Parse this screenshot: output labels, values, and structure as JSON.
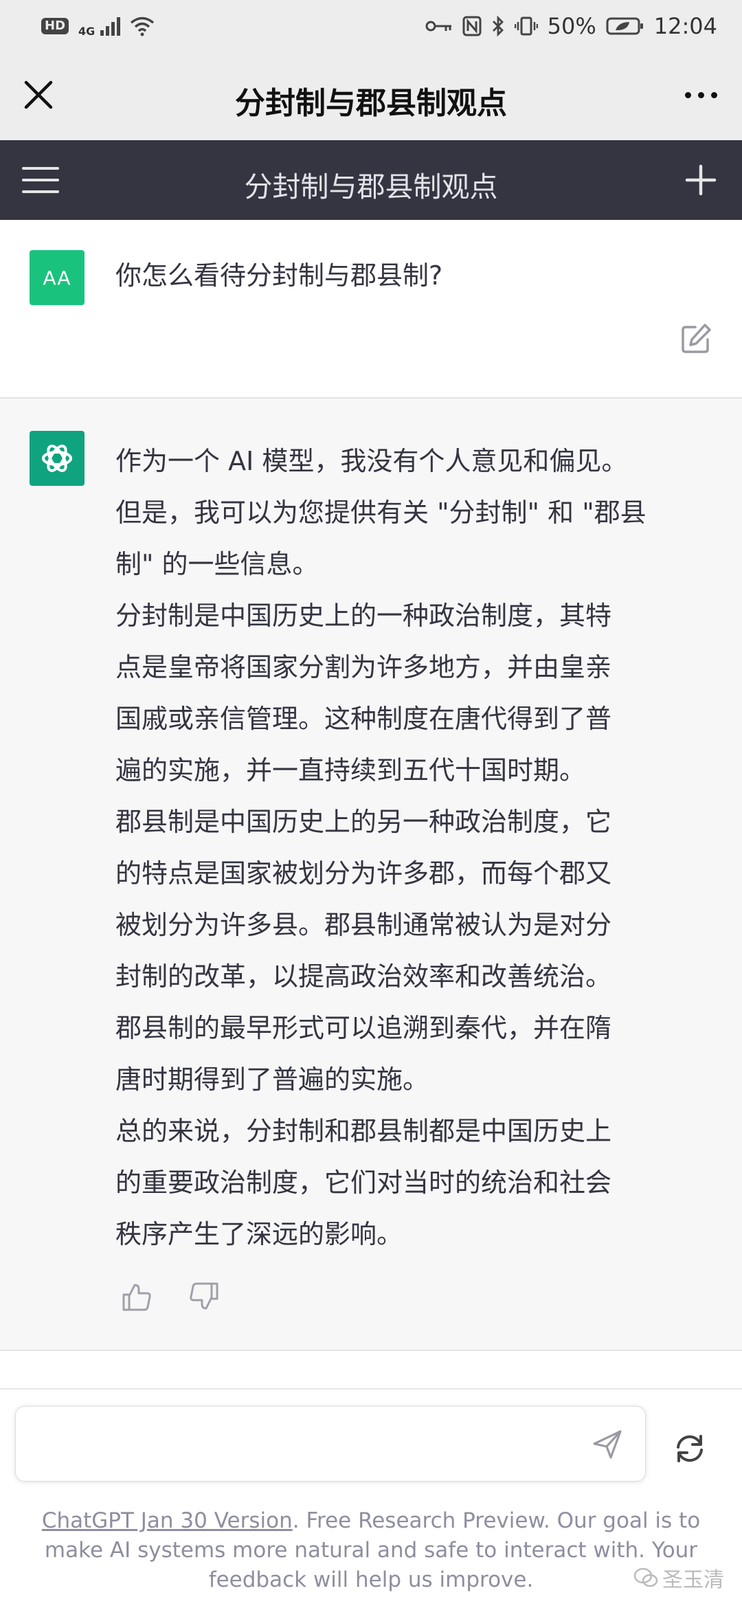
{
  "status_bar": {
    "hd": "HD",
    "network": "4G",
    "battery": "50%",
    "time": "12:04"
  },
  "wechat_bar": {
    "title": "分封制与郡县制观点"
  },
  "chat_header": {
    "title": "分封制与郡县制观点"
  },
  "user_message": {
    "avatar_initials": "AA",
    "text": "你怎么看待分封制与郡县制?"
  },
  "assistant_message": {
    "lines": [
      "作为一个 AI 模型，我没有个人意见和偏见。",
      "但是，我可以为您提供有关 \"分封制\" 和 \"郡县",
      "制\" 的一些信息。",
      "分封制是中国历史上的一种政治制度，其特",
      "点是皇帝将国家分割为许多地方，并由皇亲",
      "国戚或亲信管理。这种制度在唐代得到了普",
      "遍的实施，并一直持续到五代十国时期。",
      "郡县制是中国历史上的另一种政治制度，它",
      "的特点是国家被划分为许多郡，而每个郡又",
      "被划分为许多县。郡县制通常被认为是对分",
      "封制的改革，以提高政治效率和改善统治。",
      "郡县制的最早形式可以追溯到秦代，并在隋",
      "唐时期得到了普遍的实施。",
      "总的来说，分封制和郡县制都是中国历史上",
      "的重要政治制度，它们对当时的统治和社会",
      "秩序产生了深远的影响。"
    ]
  },
  "input": {
    "placeholder": "",
    "value": ""
  },
  "footer": {
    "version_link": "ChatGPT Jan 30 Version",
    "disclaimer": ". Free Research Preview. Our goal is to make AI systems more natural and safe to interact with. Your feedback will help us improve."
  },
  "watermark": {
    "text": "圣玉清"
  },
  "icons": {
    "close": "close-icon",
    "more": "more-icon",
    "menu": "menu-icon",
    "plus": "plus-icon",
    "edit": "edit-icon",
    "thumb_up": "thumb-up-icon",
    "thumb_down": "thumb-down-icon",
    "send": "send-icon",
    "regenerate": "regenerate-icon"
  },
  "colors": {
    "header_bg": "#343541",
    "user_avatar": "#19c37d",
    "bot_avatar": "#10a37f",
    "bot_bg": "#f7f7f8",
    "wechat_bar_bg": "#ededed"
  }
}
